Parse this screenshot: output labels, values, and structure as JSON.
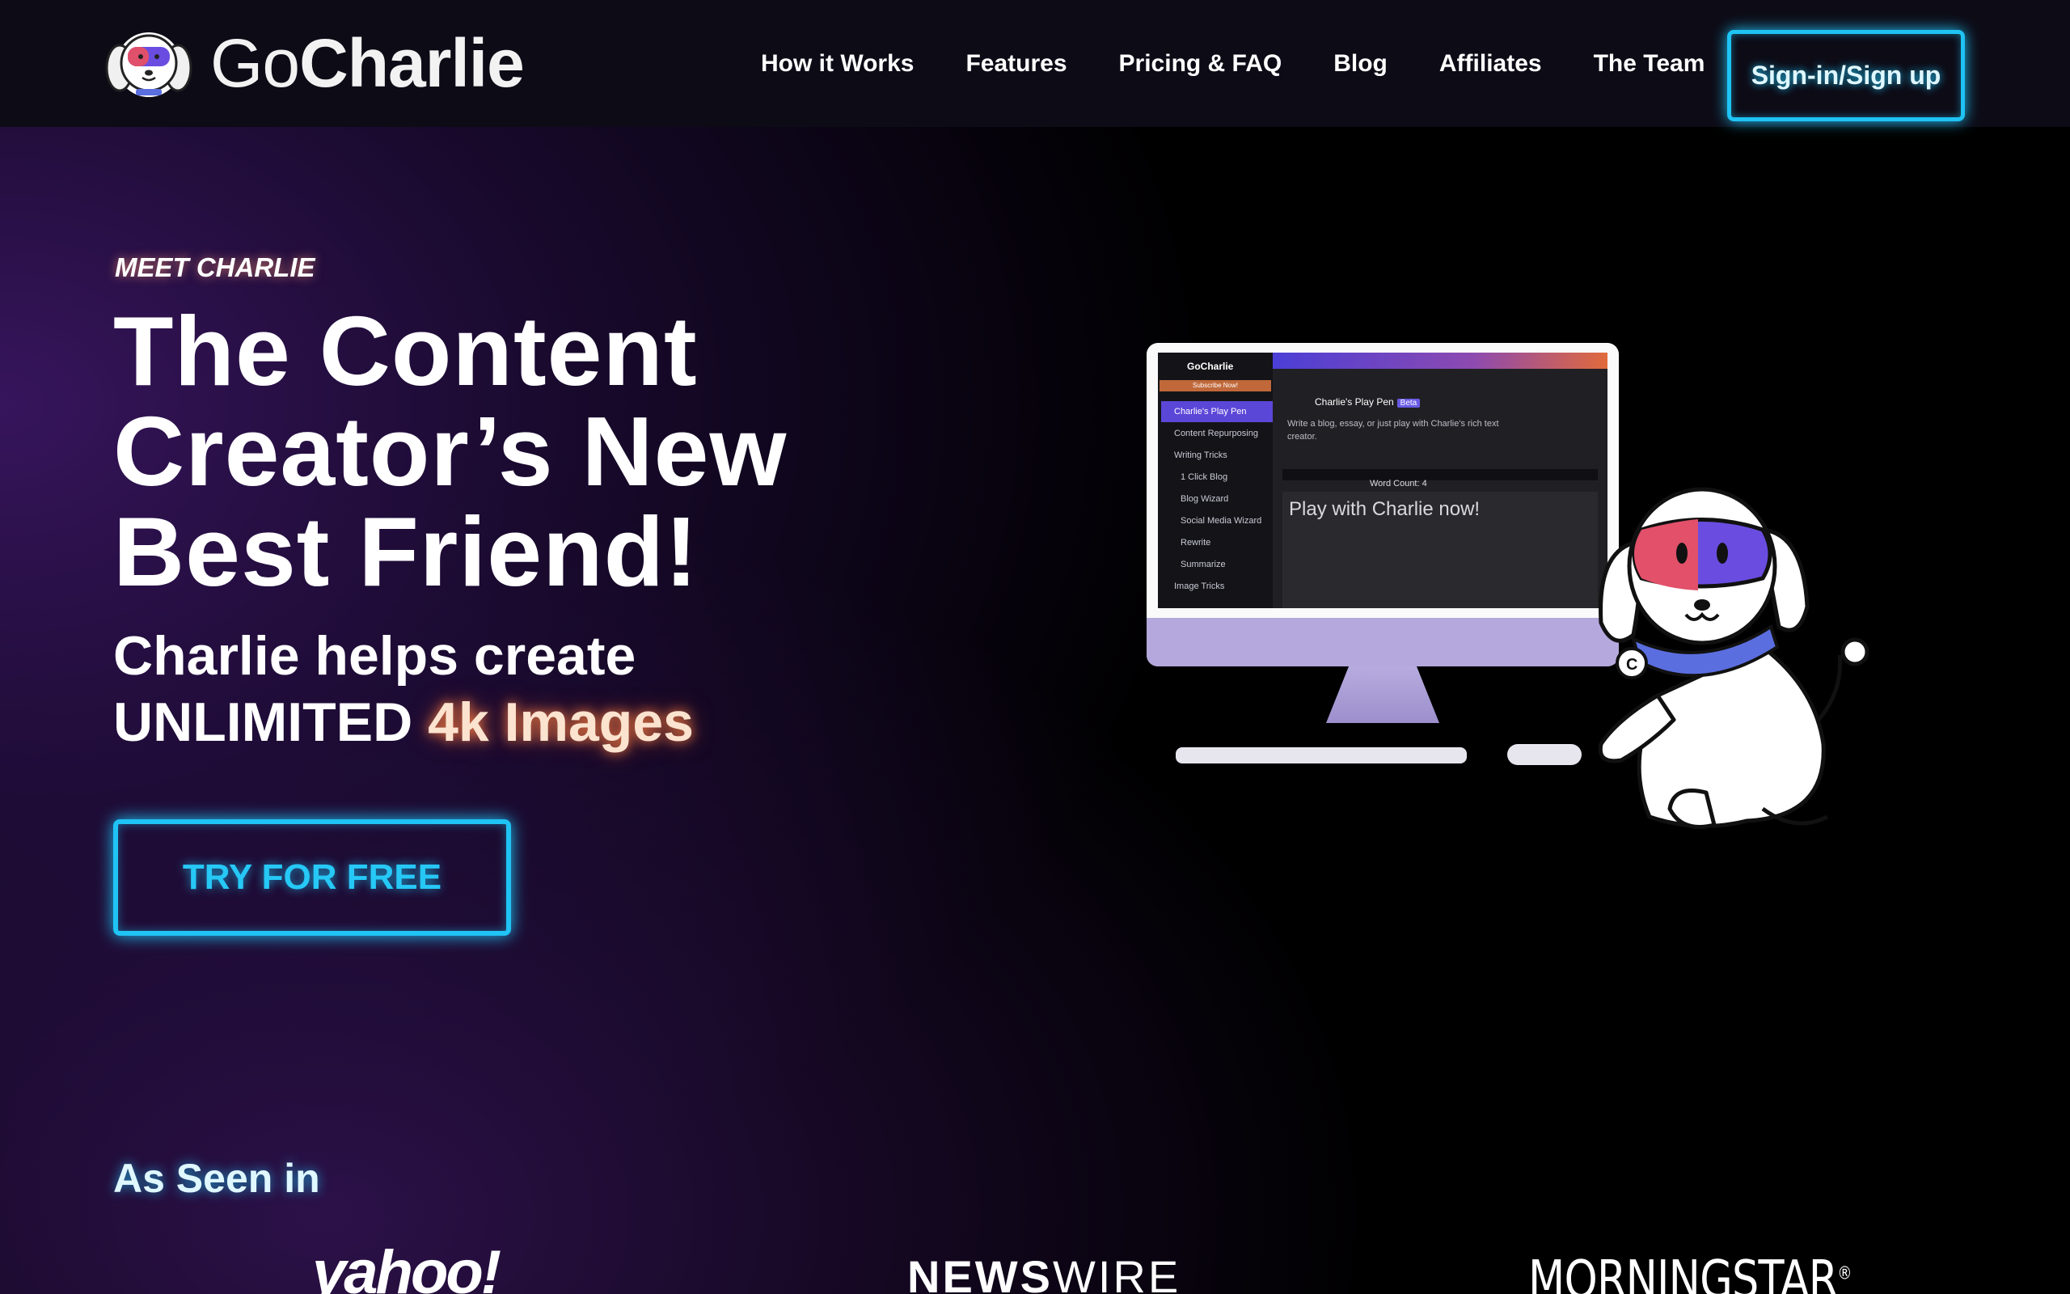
{
  "brand": {
    "name_go": "Go",
    "name_charlie": "Charlie"
  },
  "nav": {
    "items": [
      "How it Works",
      "Features",
      "Pricing & FAQ",
      "Blog",
      "Affiliates",
      "The Team"
    ],
    "signin_label": "Sign-in/Sign up"
  },
  "hero": {
    "eyebrow": "MEET CHARLIE",
    "headline_line1": "The Content",
    "headline_line2": "Creator’s New",
    "headline_line3": "Best Friend!",
    "subhead_line1": "Charlie helps create",
    "subhead_line2_prefix": "UNLIMITED ",
    "subhead_line2_accent": "4k Images",
    "cta_label": "TRY FOR FREE"
  },
  "app_preview": {
    "brand": "GoCharlie",
    "subscribe": "Subscribe Now!",
    "sidebar_items": [
      "Charlie's Play Pen",
      "Content Repurposing",
      "Writing Tricks",
      "1 Click Blog",
      "Blog Wizard",
      "Social Media Wizard",
      "Rewrite",
      "Summarize",
      "Image Tricks"
    ],
    "playpen_title": "Charlie's Play Pen",
    "beta_badge": "Beta",
    "playpen_desc": "Write a blog, essay, or just play with Charlie's rich text creator.",
    "word_count": "Word Count: 4",
    "editor_text": "Play with Charlie now!"
  },
  "press": {
    "title": "As Seen in",
    "outlets": {
      "yahoo": "yahoo!",
      "newswire_a": "NEWS",
      "newswire_b": "WIRE",
      "morningstar": "MORNINGSTAR",
      "morningstar_mark": "®"
    }
  },
  "colors": {
    "accent_cyan": "#1fc3f4",
    "accent_orange": "#ff8246",
    "nav_bg": "#0d0b16",
    "app_purple": "#5a47d8"
  },
  "icons": [
    "gocharlie-dog-logo-icon",
    "charlie-dog-mascot-illustration"
  ]
}
